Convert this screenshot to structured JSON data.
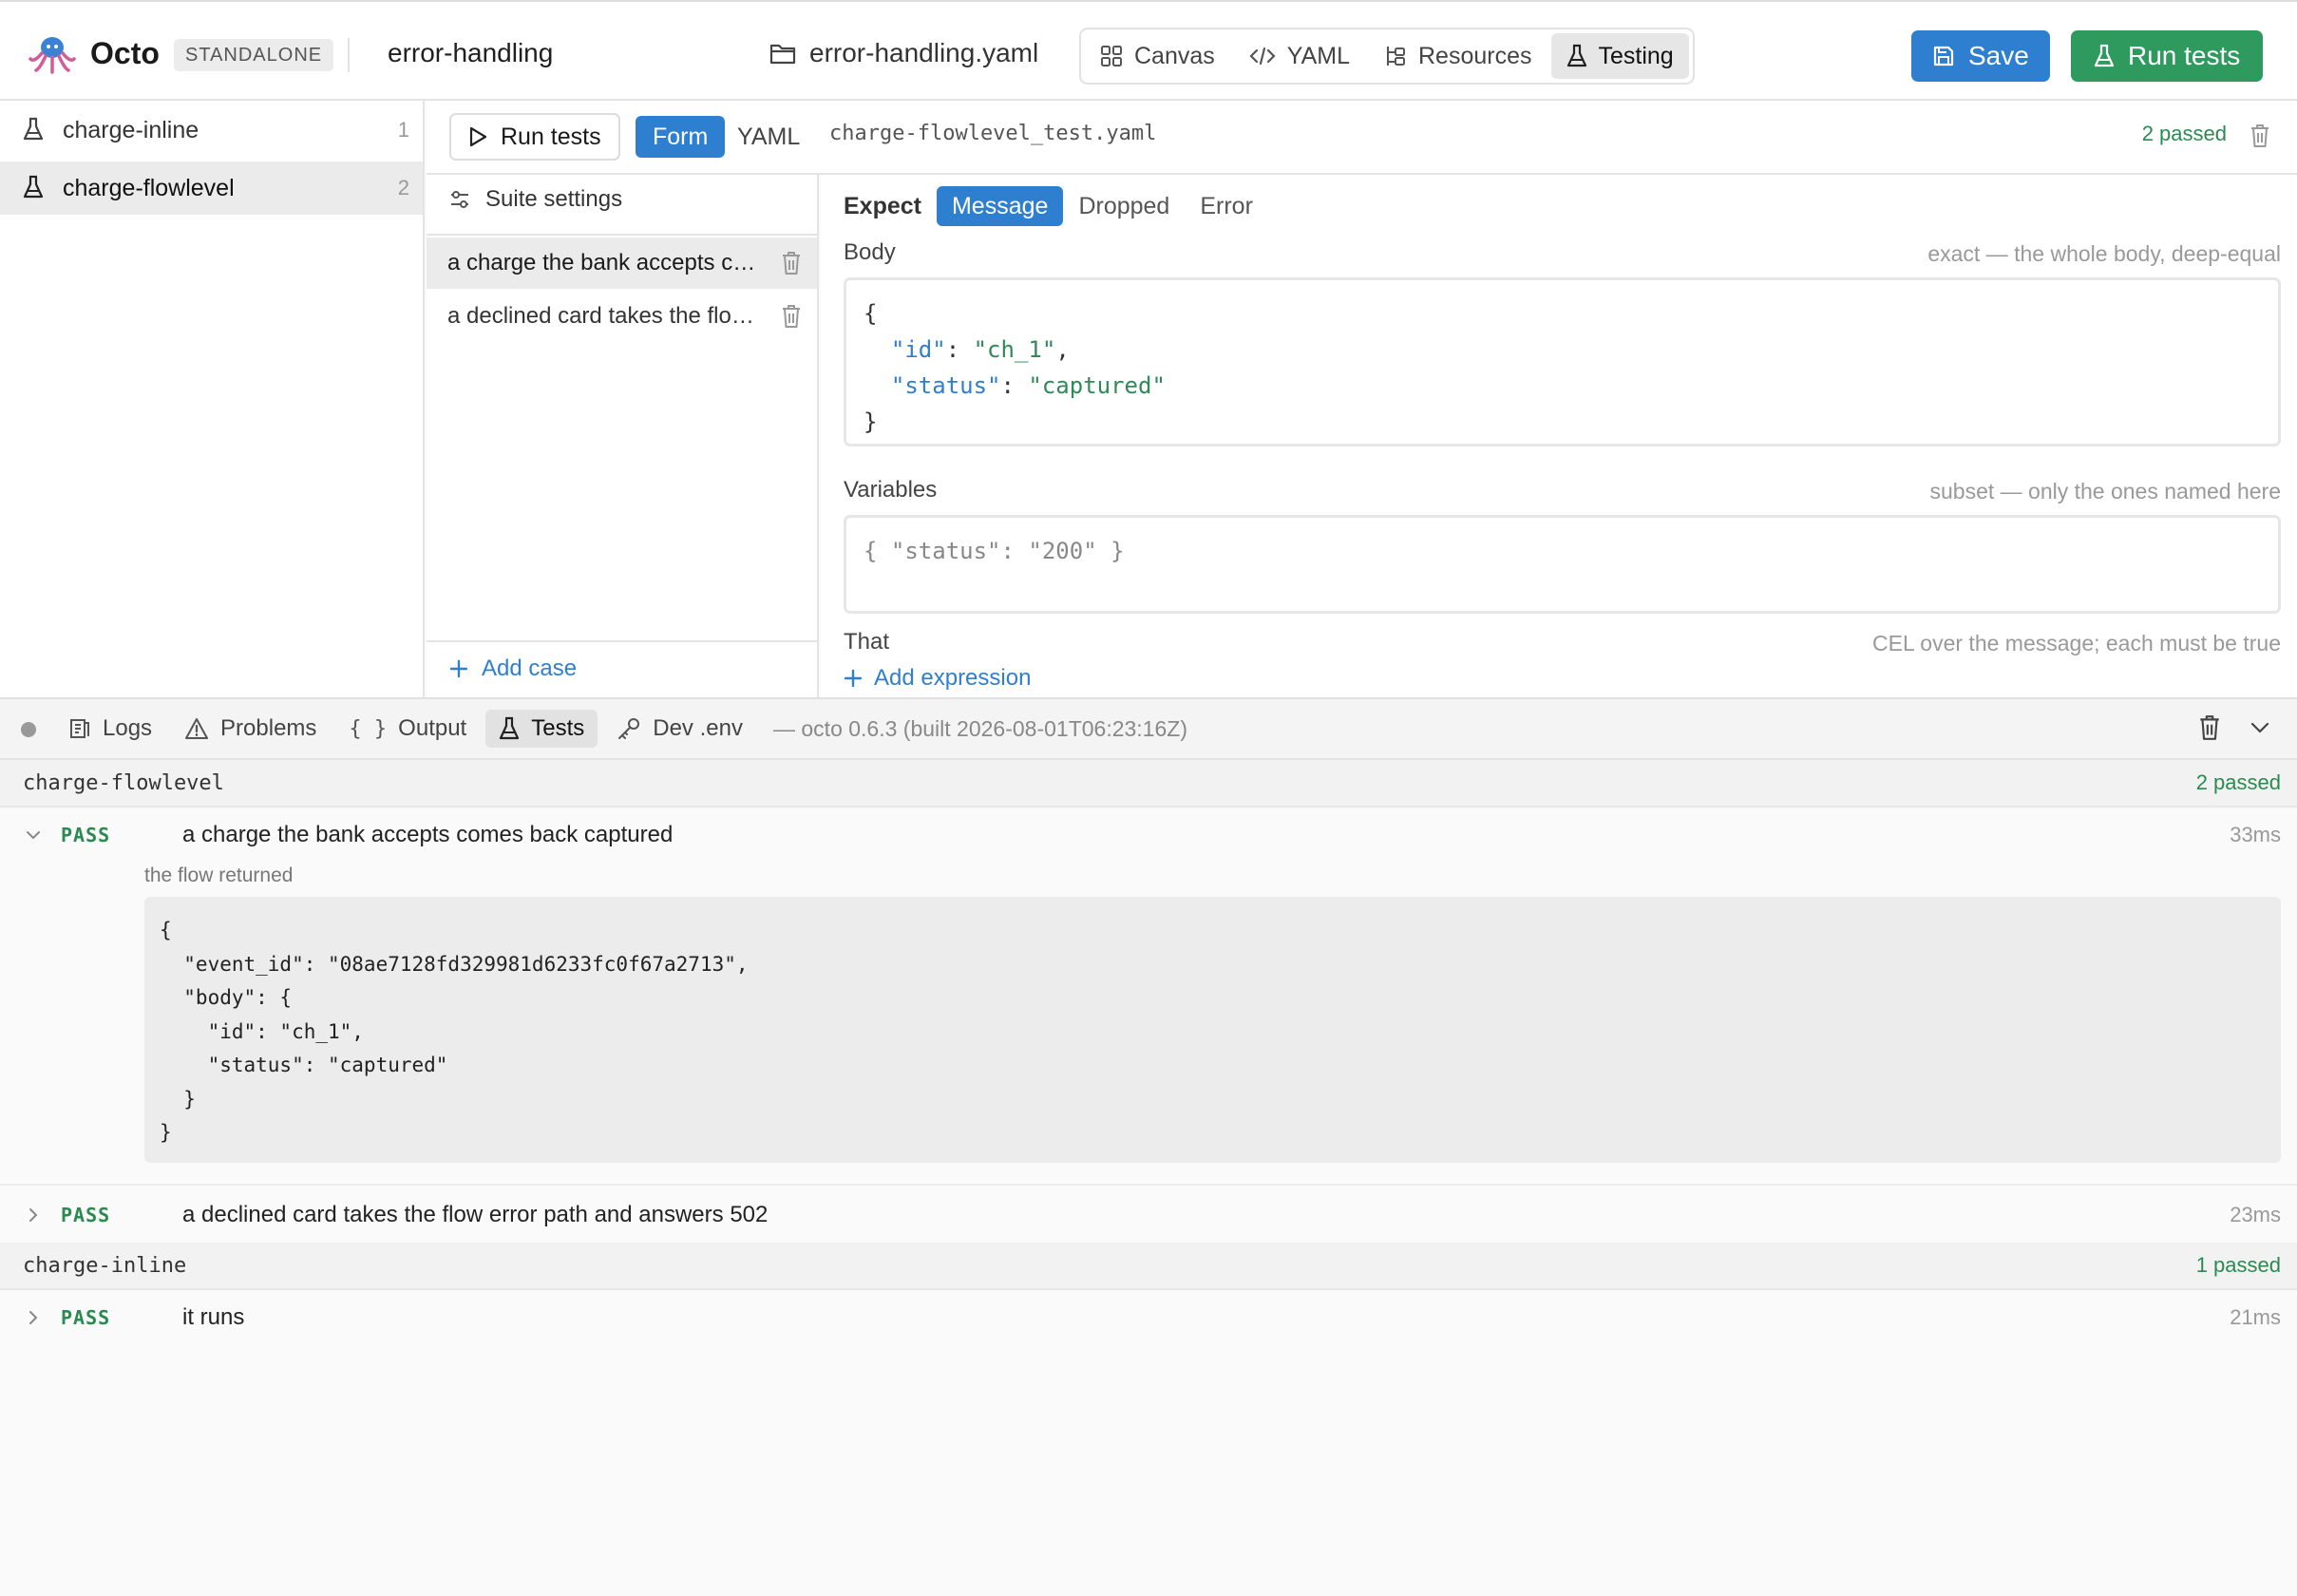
{
  "topbar": {
    "app_name": "Octo",
    "badge": "STANDALONE",
    "project_name": "error-handling",
    "file_name": "error-handling.yaml",
    "view_tabs": [
      {
        "label": "Canvas",
        "icon": "grid-icon"
      },
      {
        "label": "YAML",
        "icon": "code-icon"
      },
      {
        "label": "Resources",
        "icon": "resources-icon"
      },
      {
        "label": "Testing",
        "icon": "flask-icon",
        "active": true
      }
    ],
    "save_label": "Save",
    "run_tests_label": "Run tests",
    "colors": {
      "primary": "#2f7fd0",
      "success": "#2e9a5e"
    }
  },
  "sidebar": {
    "suites": [
      {
        "name": "charge-inline",
        "count": "1"
      },
      {
        "name": "charge-flowlevel",
        "count": "2",
        "active": true
      }
    ]
  },
  "editor": {
    "run_tests_label": "Run tests",
    "form_label": "Form",
    "yaml_label": "YAML",
    "test_file": "charge-flowlevel_test.yaml",
    "passed": "2 passed"
  },
  "cases": {
    "suite_settings": "Suite settings",
    "items": [
      {
        "label": "a charge the bank accepts comes back captured",
        "active": true
      },
      {
        "label": "a declined card takes the flow error path and answers 502"
      }
    ],
    "add_case": "Add case"
  },
  "expect": {
    "label": "Expect",
    "tabs": [
      "Message",
      "Dropped",
      "Error"
    ],
    "active_tab": "Message",
    "body": {
      "label": "Body",
      "hint": "exact — the whole body, deep-equal",
      "open": "{",
      "line1_key": "\"id\"",
      "line1_val": "\"ch_1\"",
      "line2_key": "\"status\"",
      "line2_val": "\"captured\"",
      "close": "}"
    },
    "variables": {
      "label": "Variables",
      "hint": "subset — only the ones named here",
      "placeholder": "{ \"status\": \"200\" }"
    },
    "that": {
      "label": "That",
      "hint": "CEL over the message; each must be true",
      "add_expression": "Add expression"
    }
  },
  "bottom": {
    "tabs": [
      {
        "label": "Logs",
        "icon": "logs-icon"
      },
      {
        "label": "Problems",
        "icon": "warning-icon"
      },
      {
        "label": "Output",
        "icon": "braces-icon"
      },
      {
        "label": "Tests",
        "icon": "flask-icon",
        "active": true
      },
      {
        "label": "Dev .env",
        "icon": "key-icon"
      }
    ],
    "version": "— octo 0.6.3 (built 2026-08-01T06:23:16Z)",
    "groups": [
      {
        "name": "charge-flowlevel",
        "passed": "2 passed",
        "results": [
          {
            "status": "PASS",
            "name": "a charge the bank accepts comes back captured",
            "time": "33ms",
            "expanded": true,
            "returned_label": "the flow returned",
            "returned": "{\n  \"event_id\": \"08ae7128fd329981d6233fc0f67a2713\",\n  \"body\": {\n    \"id\": \"ch_1\",\n    \"status\": \"captured\"\n  }\n}"
          },
          {
            "status": "PASS",
            "name": "a declined card takes the flow error path and answers 502",
            "time": "23ms"
          }
        ]
      },
      {
        "name": "charge-inline",
        "passed": "1 passed",
        "results": [
          {
            "status": "PASS",
            "name": "it runs",
            "time": "21ms"
          }
        ]
      }
    ]
  }
}
